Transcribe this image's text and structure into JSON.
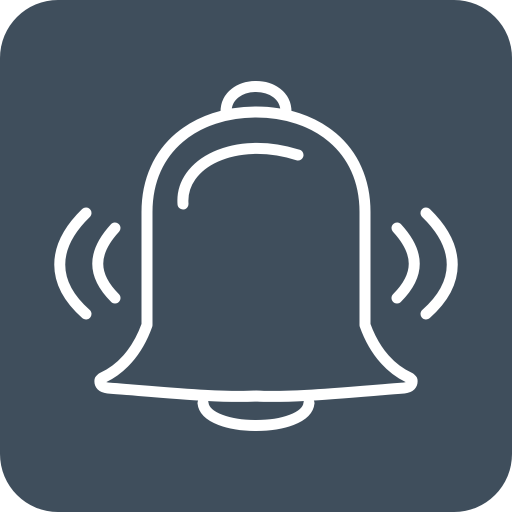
{
  "icon": {
    "name": "bell-ringing-icon",
    "background_color": "#3F4E5C",
    "stroke_color": "#FFFFFF",
    "page_background": "#FFFFFF"
  }
}
